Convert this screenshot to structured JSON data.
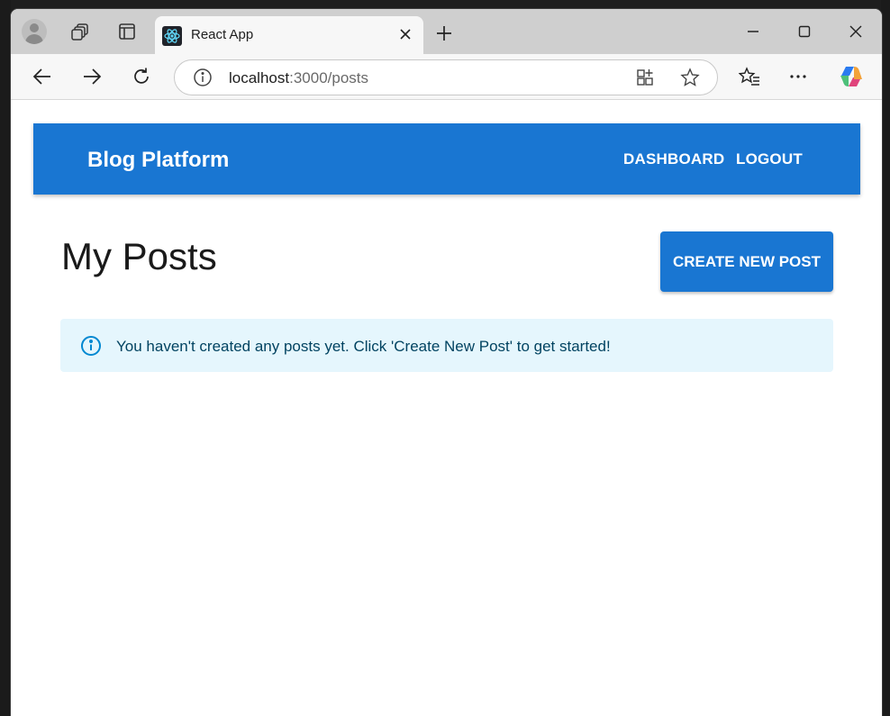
{
  "browser": {
    "tab_title": "React App",
    "url_host": "localhost",
    "url_path": ":3000/posts"
  },
  "app": {
    "brand": "Blog Platform",
    "nav": [
      "DASHBOARD",
      "LOGOUT"
    ],
    "page_title": "My Posts",
    "create_button": "CREATE NEW POST",
    "alert": "You haven't created any posts yet. Click 'Create New Post' to get started!"
  },
  "colors": {
    "primary": "#1976d2",
    "alert_bg": "#e5f6fd",
    "alert_text": "#014361",
    "info_icon": "#0288d1"
  }
}
